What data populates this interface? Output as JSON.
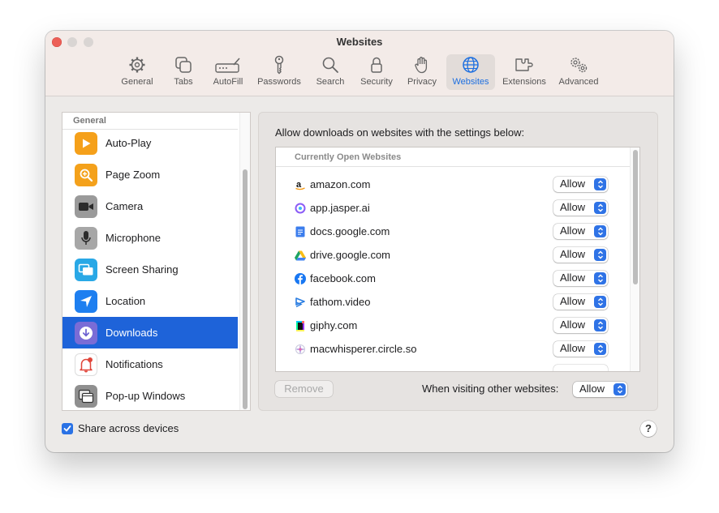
{
  "window": {
    "title": "Websites"
  },
  "toolbar": {
    "items": [
      {
        "label": "General",
        "icon": "gear-icon"
      },
      {
        "label": "Tabs",
        "icon": "tabs-icon"
      },
      {
        "label": "AutoFill",
        "icon": "autofill-icon"
      },
      {
        "label": "Passwords",
        "icon": "key-icon"
      },
      {
        "label": "Search",
        "icon": "search-icon"
      },
      {
        "label": "Security",
        "icon": "lock-icon"
      },
      {
        "label": "Privacy",
        "icon": "hand-icon"
      },
      {
        "label": "Websites",
        "icon": "globe-icon",
        "active": true
      },
      {
        "label": "Extensions",
        "icon": "puzzle-icon"
      },
      {
        "label": "Advanced",
        "icon": "gears-icon"
      }
    ]
  },
  "sidebar": {
    "section": "General",
    "items": [
      {
        "label": "Auto-Play",
        "icon": "play-icon"
      },
      {
        "label": "Page Zoom",
        "icon": "zoom-icon"
      },
      {
        "label": "Camera",
        "icon": "camera-icon"
      },
      {
        "label": "Microphone",
        "icon": "microphone-icon"
      },
      {
        "label": "Screen Sharing",
        "icon": "screen-sharing-icon"
      },
      {
        "label": "Location",
        "icon": "location-arrow-icon"
      },
      {
        "label": "Downloads",
        "icon": "download-icon",
        "selected": true
      },
      {
        "label": "Notifications",
        "icon": "bell-icon"
      },
      {
        "label": "Pop-up Windows",
        "icon": "popup-windows-icon"
      }
    ]
  },
  "panel": {
    "heading": "Allow downloads on websites with the settings below:",
    "table_header": "Currently Open Websites",
    "sites": [
      {
        "name": "amazon.com",
        "value": "Allow",
        "icon": "amazon-favicon"
      },
      {
        "name": "app.jasper.ai",
        "value": "Allow",
        "icon": "jasper-favicon"
      },
      {
        "name": "docs.google.com",
        "value": "Allow",
        "icon": "google-docs-favicon"
      },
      {
        "name": "drive.google.com",
        "value": "Allow",
        "icon": "google-drive-favicon"
      },
      {
        "name": "facebook.com",
        "value": "Allow",
        "icon": "facebook-favicon"
      },
      {
        "name": "fathom.video",
        "value": "Allow",
        "icon": "fathom-favicon"
      },
      {
        "name": "giphy.com",
        "value": "Allow",
        "icon": "giphy-favicon"
      },
      {
        "name": "macwhisperer.circle.so",
        "value": "Allow",
        "icon": "circle-favicon"
      }
    ],
    "remove_label": "Remove",
    "other_label": "When visiting other websites:",
    "other_value": "Allow"
  },
  "footer": {
    "share_label": "Share across devices",
    "share_checked": true,
    "help_label": "?"
  },
  "colors": {
    "accent": "#1e63d9",
    "close": "#ec5f57"
  }
}
